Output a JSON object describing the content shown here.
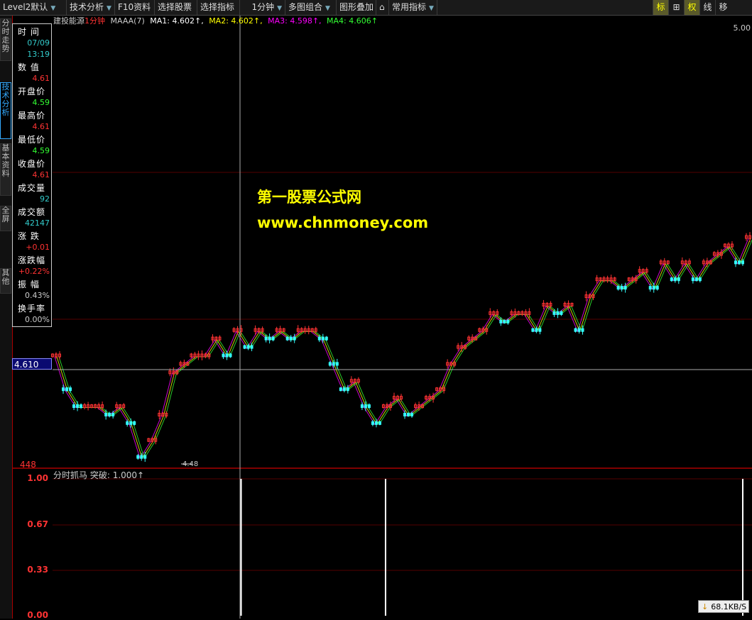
{
  "toolbar": {
    "items": [
      "Level2默认",
      "技术分析",
      "F10资料",
      "选择股票",
      "选择指标",
      "1分钟",
      "多图组合",
      "图形叠加",
      "常用指标"
    ],
    "right_buttons": [
      "标",
      "⊞",
      "权",
      "线",
      "移"
    ]
  },
  "side_tabs": [
    "分时走势",
    "技术分析",
    "基本资料",
    "全屏",
    "其他"
  ],
  "info_panel": {
    "time_label": "时  间",
    "date": "07/09",
    "time": "13:19",
    "value_label": "数  值",
    "value": "4.61",
    "open_label": "开盘价",
    "open": "4.59",
    "high_label": "最高价",
    "high": "4.61",
    "low_label": "最低价",
    "low": "4.59",
    "close_label": "收盘价",
    "close": "4.61",
    "volume_label": "成交量",
    "volume": "92",
    "amount_label": "成交额",
    "amount": "42147",
    "change_label": "涨  跌",
    "change": "+0.01",
    "change_pct_label": "涨跌幅",
    "change_pct": "+0.22%",
    "amplitude_label": "振  幅",
    "amplitude": "0.43%",
    "turnover_label": "换手率",
    "turnover": "0.00%"
  },
  "header": {
    "stock": "建投能源",
    "period": "1分钟",
    "indicator": "MAAA(7)",
    "ma1": "MA1: 4.602↑,",
    "ma2": "MA2: 4.602↑,",
    "ma3": "MA3: 4.598↑,",
    "ma4": "MA4: 4.606↑"
  },
  "watermark": {
    "line1": "第一股票公式网",
    "line2": "www.chnmoney.com"
  },
  "price_axis": {
    "current": "4.610",
    "low": "448",
    "top_right": "5.00",
    "low_marker": "4.48"
  },
  "sub_chart": {
    "title": "分时抓马",
    "indicator": "突破: 1.000↑",
    "y_ticks": [
      "1.00",
      "0.67",
      "0.33",
      "0.00"
    ]
  },
  "network": {
    "speed": "68.1KB/S"
  },
  "colors": {
    "up": "#ff3333",
    "down": "#33ff33",
    "accent": "#ffff00",
    "frame": "#aa0000"
  },
  "chart_data": [
    {
      "type": "line",
      "name": "price",
      "x": [
        0,
        15,
        30,
        45,
        60,
        75,
        90,
        105,
        120,
        135,
        150,
        165,
        180,
        195,
        210,
        225,
        240,
        255,
        270,
        285,
        300,
        315,
        330,
        345,
        360,
        375,
        390,
        405,
        420,
        435,
        450,
        465,
        480,
        495,
        510,
        525,
        540,
        555,
        570,
        585,
        600,
        615,
        630,
        645,
        660,
        675,
        690,
        705,
        720,
        735,
        750,
        765,
        780,
        795,
        810,
        825,
        840,
        855,
        870,
        885,
        900,
        915,
        930,
        945,
        960,
        975
      ],
      "values": [
        4.61,
        4.57,
        4.55,
        4.55,
        4.55,
        4.54,
        4.55,
        4.53,
        4.49,
        4.51,
        4.54,
        4.59,
        4.6,
        4.61,
        4.61,
        4.63,
        4.61,
        4.64,
        4.62,
        4.64,
        4.63,
        4.64,
        4.63,
        4.64,
        4.64,
        4.63,
        4.6,
        4.57,
        4.58,
        4.55,
        4.53,
        4.55,
        4.56,
        4.54,
        4.55,
        4.56,
        4.57,
        4.6,
        4.62,
        4.63,
        4.64,
        4.66,
        4.65,
        4.66,
        4.66,
        4.64,
        4.67,
        4.66,
        4.67,
        4.64,
        4.68,
        4.7,
        4.7,
        4.69,
        4.7,
        4.71,
        4.69,
        4.72,
        4.7,
        4.72,
        4.7,
        4.72,
        4.73,
        4.74,
        4.72,
        4.75
      ],
      "ylim": [
        4.48,
        5.0
      ]
    },
    {
      "type": "bar",
      "name": "突破",
      "x": [
        265,
        468,
        970
      ],
      "values": [
        1.0,
        1.0,
        1.0
      ],
      "ylim": [
        0,
        1
      ]
    }
  ]
}
